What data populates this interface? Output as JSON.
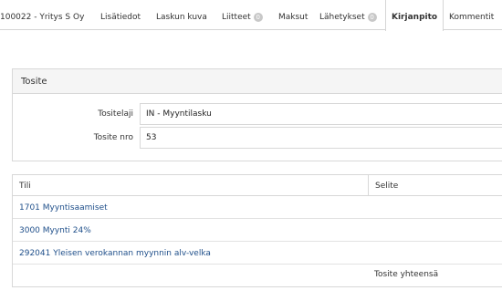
{
  "tabs": [
    {
      "label": "100022 - Yritys S Oy"
    },
    {
      "label": "Lisätiedot"
    },
    {
      "label": "Laskun kuva"
    },
    {
      "label": "Liitteet",
      "badge": "0"
    },
    {
      "label": "Maksut"
    },
    {
      "label": "Lähetykset",
      "badge": "0"
    },
    {
      "label": "Kirjanpito",
      "active": true
    },
    {
      "label": "Kommentit"
    }
  ],
  "voucher": {
    "title": "Tosite",
    "type_label": "Tositelaji",
    "type_value": "IN - Myyntilasku",
    "number_label": "Tosite nro",
    "number_value": "53"
  },
  "table": {
    "col_account": "Tili",
    "col_description": "Selite",
    "rows": [
      {
        "account": "1701 Myyntisaamiset"
      },
      {
        "account": "3000 Myynti 24%"
      },
      {
        "account": "292041 Yleisen verokannan myynnin alv-velka"
      }
    ],
    "total_label": "Tosite yhteensä"
  }
}
